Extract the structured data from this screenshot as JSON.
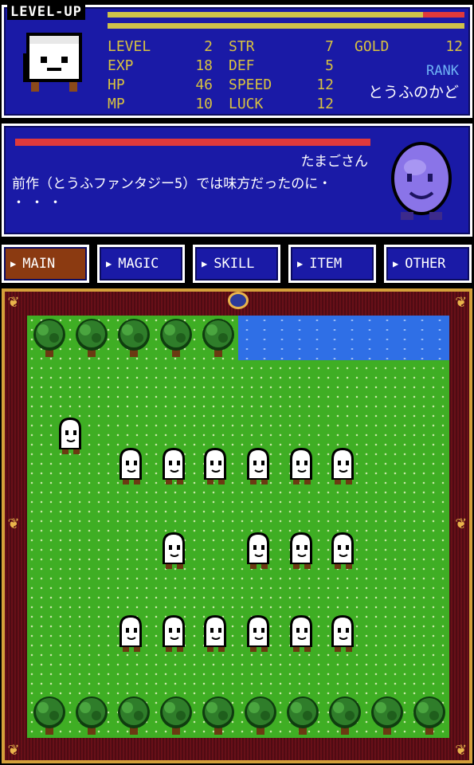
{
  "header": {
    "levelup_label": "LEVEL-UP"
  },
  "hp_bar": {
    "remaining_fraction": 0.885
  },
  "player": {
    "stats": [
      {
        "label": "LEVEL",
        "value": "2"
      },
      {
        "label": "EXP",
        "value": "18"
      },
      {
        "label": "HP",
        "value": "46"
      },
      {
        "label": "MP",
        "value": "10"
      },
      {
        "label": "STR",
        "value": "7"
      },
      {
        "label": "DEF",
        "value": "5"
      },
      {
        "label": "SPEED",
        "value": "12"
      },
      {
        "label": "LUCK",
        "value": "12"
      },
      {
        "label": "GOLD",
        "value": "12"
      }
    ],
    "rank_label": "RANK",
    "rank_value": "とうふのかど"
  },
  "dialog": {
    "speaker": "たまごさん",
    "line1": "前作（とうふファンタジー5）では味方だったのに・",
    "line2": "・・・"
  },
  "menu": {
    "items": [
      {
        "label": "MAIN",
        "active": true
      },
      {
        "label": "MAGIC",
        "active": false
      },
      {
        "label": "SKILL",
        "active": false
      },
      {
        "label": "ITEM",
        "active": false
      },
      {
        "label": "OTHER",
        "active": false
      }
    ]
  },
  "colors": {
    "panel_blue": "#1a1aa6",
    "stat_gold": "#d8c240",
    "rank_blue": "#6fb2f5",
    "hp_red": "#e0393b",
    "active_tab": "#8b3a11",
    "grass": "#3fae24",
    "water": "#2f6fe6"
  },
  "icons": {
    "menu_arrow": "▶"
  }
}
